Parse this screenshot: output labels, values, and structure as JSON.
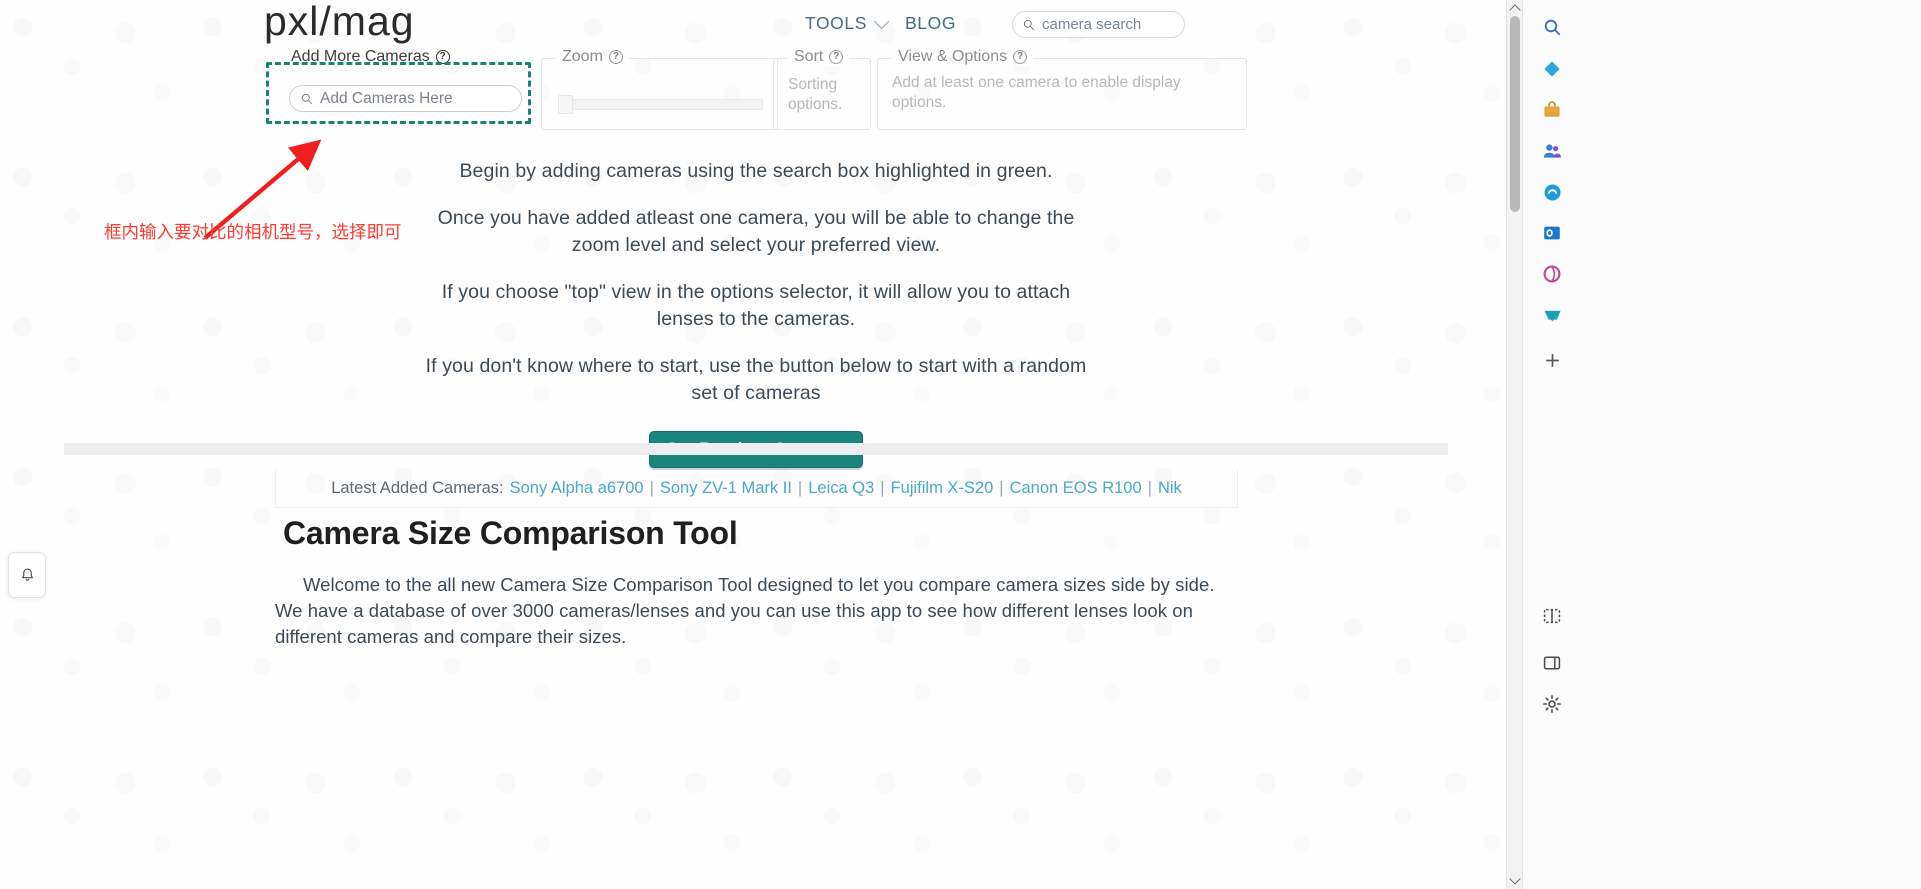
{
  "header": {
    "logo": "pxl/mag",
    "nav": [
      {
        "label": "TOOLS",
        "has_caret": true
      },
      {
        "label": "BLOG",
        "has_caret": false
      }
    ],
    "search_placeholder": "camera search",
    "search_icon": "search-icon"
  },
  "controls": {
    "add_cameras": {
      "legend": "Add More Cameras",
      "help_icon": "question-mark-icon",
      "input_placeholder": "Add Cameras Here",
      "highlight_color": "#1b8373"
    },
    "zoom": {
      "legend": "Zoom",
      "help_icon": "question-mark-icon"
    },
    "sort": {
      "legend": "Sort",
      "help_icon": "question-mark-icon",
      "body": "Sorting options."
    },
    "view_options": {
      "legend": "View & Options",
      "help_icon": "question-mark-icon",
      "body": "Add at least one camera to enable display options."
    }
  },
  "intro": {
    "lines": [
      "Begin by adding cameras using the search box highlighted in green.",
      "Once you have added atleast one camera, you will be able to change the zoom level and select your preferred view.",
      "If you choose \"top\" view in the options selector, it will allow you to attach lenses to the cameras.",
      "If you don't know where to start, use the button below to start with a random set of cameras"
    ],
    "random_button": "Get Random Cameras",
    "random_button_color": "#19857c"
  },
  "latest": {
    "label": "Latest Added Cameras:",
    "items": [
      "Sony Alpha a6700",
      "Sony ZV-1 Mark II",
      "Leica Q3",
      "Fujifilm X-S20",
      "Canon EOS R100",
      "Nik"
    ],
    "separator": "|",
    "link_color": "#4aa8c4"
  },
  "article": {
    "title": "Camera Size Comparison Tool",
    "body": "Welcome to the all new Camera Size Comparison Tool designed to let you compare camera sizes side by side. We have a database of over 3000 cameras/lenses and you can use this app to see how different lenses look on different cameras and compare their sizes."
  },
  "annotation": {
    "text": "框内输入要对比的相机型号，选择即可",
    "color": "#ff3b30",
    "arrow": "red-arrow-annotation"
  },
  "browser_sidebar": {
    "icons": [
      "search-icon",
      "diamond-icon",
      "briefcase-icon",
      "people-icon",
      "copilot-icon",
      "outlook-icon",
      "browser-essentials-icon",
      "shopping-icon",
      "add-icon",
      "split-screen-icon",
      "sidebar-toggle-icon",
      "settings-gear-icon"
    ]
  },
  "notification": {
    "icon": "bell-icon"
  }
}
